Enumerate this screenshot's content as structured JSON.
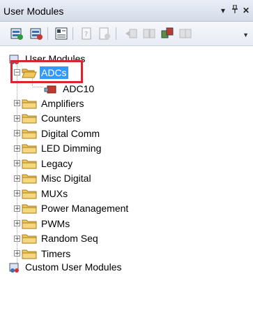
{
  "panel": {
    "title": "User Modules"
  },
  "titlebar": {
    "pin_icon": "pin-icon",
    "dropdown_icon": "dropdown-arrow-icon",
    "close_icon": "close-icon"
  },
  "toolbar": {
    "icons": [
      "place-module-icon",
      "unplace-module-icon",
      "properties-icon",
      "datasheet-icon",
      "help-icon",
      "move-left-icon",
      "move-right-icon",
      "rotate-icon",
      "config-icon"
    ]
  },
  "tree": {
    "root": "User Modules",
    "expanded": {
      "label": "ADCs",
      "children": [
        "ADC10"
      ]
    },
    "folders": [
      "Amplifiers",
      "Counters",
      "Digital Comm",
      "LED Dimming",
      "Legacy",
      "Misc Digital",
      "MUXs",
      "Power Management",
      "PWMs",
      "Random Seq",
      "Timers"
    ],
    "custom": "Custom User Modules"
  },
  "colors": {
    "selection": "#3399ff",
    "highlight": "#d9262c",
    "folder": "#f3c85a"
  }
}
